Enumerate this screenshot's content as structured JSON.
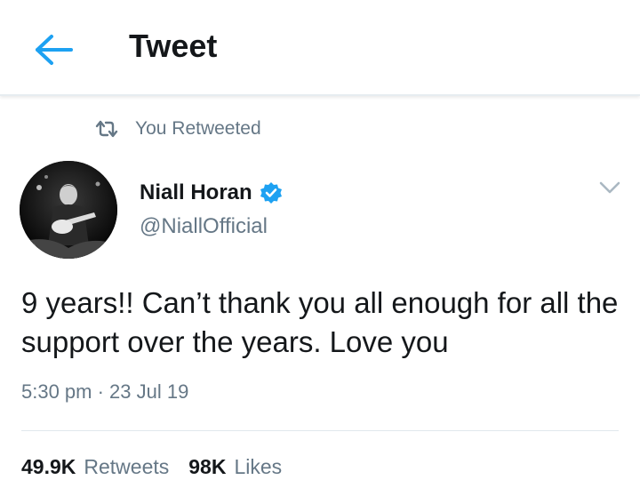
{
  "header": {
    "title": "Tweet",
    "back_icon": "arrow-left-icon"
  },
  "retweet_context": {
    "label": "You Retweeted",
    "icon": "retweet-icon"
  },
  "tweet": {
    "author_name": "Niall Horan",
    "handle": "@NiallOfficial",
    "verified": true,
    "text": "9 years!! Can’t thank you all enough for all the support over the years. Love you",
    "timestamp": "5:30 pm · 23 Jul 19",
    "stats": {
      "retweets_count": "49.9K",
      "retweets_label": "Retweets",
      "likes_count": "98K",
      "likes_label": "Likes"
    }
  },
  "colors": {
    "accent": "#1da1f2",
    "text_primary": "#14171a",
    "text_secondary": "#657786",
    "divider": "#e1e8ed"
  }
}
